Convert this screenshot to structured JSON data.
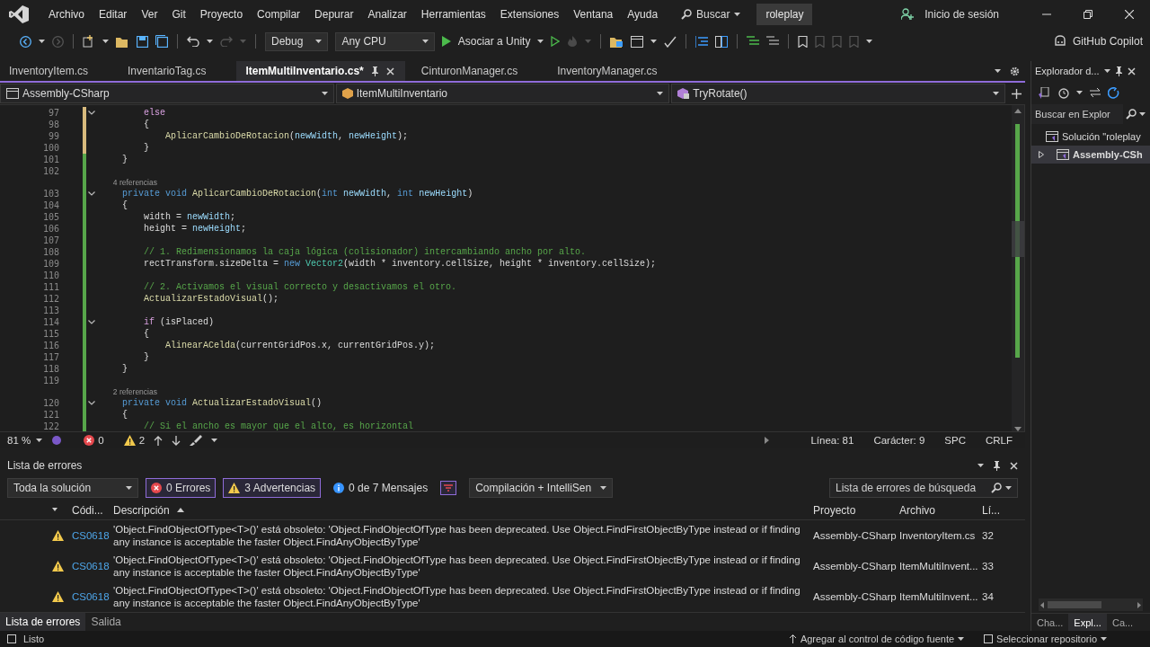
{
  "menu": {
    "items": [
      "Archivo",
      "Editar",
      "Ver",
      "Git",
      "Proyecto",
      "Compilar",
      "Depurar",
      "Analizar",
      "Herramientas",
      "Extensiones",
      "Ventana",
      "Ayuda"
    ],
    "search": "Buscar",
    "solution": "roleplay",
    "signin": "Inicio de sesión"
  },
  "toolbar": {
    "configuration": "Debug",
    "platform": "Any CPU",
    "run": "Asociar a Unity",
    "copilot": "GitHub Copilot"
  },
  "tabs": [
    {
      "label": "InventoryItem.cs",
      "selected": false
    },
    {
      "label": "InventarioTag.cs",
      "selected": false
    },
    {
      "label": "ItemMultiInventario.cs*",
      "selected": true
    },
    {
      "label": "CinturonManager.cs",
      "selected": false
    },
    {
      "label": "InventoryManager.cs",
      "selected": false
    }
  ],
  "navigation": {
    "project": "Assembly-CSharp",
    "type": "ItemMultiInventario",
    "member": "TryRotate()"
  },
  "code": [
    {
      "kind": "code",
      "number": "97",
      "saved": false,
      "collapsible": true,
      "tokens": [
        {
          "kind": "ctl",
          "text": "            else"
        }
      ]
    },
    {
      "kind": "code",
      "number": "98",
      "saved": false,
      "collapsible": false,
      "tokens": [
        {
          "kind": "p",
          "text": "            {"
        }
      ]
    },
    {
      "kind": "code",
      "number": "99",
      "saved": false,
      "collapsible": false,
      "tokens": [
        {
          "kind": "fn",
          "text": "                AplicarCambioDeRotacion"
        },
        {
          "kind": "p",
          "text": "("
        },
        {
          "kind": "param",
          "text": "newWidth"
        },
        {
          "kind": "p",
          "text": ", "
        },
        {
          "kind": "param",
          "text": "newHeight"
        },
        {
          "kind": "p",
          "text": ");"
        }
      ]
    },
    {
      "kind": "code",
      "number": "100",
      "saved": false,
      "collapsible": false,
      "tokens": [
        {
          "kind": "p",
          "text": "            }"
        }
      ]
    },
    {
      "kind": "code",
      "number": "101",
      "saved": true,
      "collapsible": false,
      "tokens": [
        {
          "kind": "p",
          "text": "        }"
        }
      ]
    },
    {
      "kind": "code",
      "number": "102",
      "saved": true,
      "collapsible": false
    },
    {
      "kind": "refs",
      "saved": true,
      "text": "4 referencias"
    },
    {
      "kind": "code",
      "number": "103",
      "saved": true,
      "collapsible": true,
      "tokens": [
        {
          "kind": "kw",
          "text": "        private void "
        },
        {
          "kind": "fn",
          "text": "AplicarCambioDeRotacion"
        },
        {
          "kind": "p",
          "text": "("
        },
        {
          "kind": "kw",
          "text": "int "
        },
        {
          "kind": "param",
          "text": "newWidth"
        },
        {
          "kind": "p",
          "text": ", "
        },
        {
          "kind": "kw",
          "text": "int "
        },
        {
          "kind": "param",
          "text": "newHeight"
        },
        {
          "kind": "p",
          "text": ")"
        }
      ]
    },
    {
      "kind": "code",
      "number": "104",
      "saved": true,
      "collapsible": false,
      "tokens": [
        {
          "kind": "p",
          "text": "        {"
        }
      ]
    },
    {
      "kind": "code",
      "number": "105",
      "saved": true,
      "collapsible": false,
      "tokens": [
        {
          "kind": "p",
          "text": "            width = "
        },
        {
          "kind": "param",
          "text": "newWidth"
        },
        {
          "kind": "p",
          "text": ";"
        }
      ]
    },
    {
      "kind": "code",
      "number": "106",
      "saved": true,
      "collapsible": false,
      "tokens": [
        {
          "kind": "p",
          "text": "            height = "
        },
        {
          "kind": "param",
          "text": "newHeight"
        },
        {
          "kind": "p",
          "text": ";"
        }
      ]
    },
    {
      "kind": "code",
      "number": "107",
      "saved": true,
      "collapsible": false
    },
    {
      "kind": "code",
      "number": "108",
      "saved": true,
      "collapsible": false,
      "tokens": [
        {
          "kind": "c",
          "text": "            // 1. Redimensionamos la caja lógica (colisionador) intercambiando ancho por alto."
        }
      ]
    },
    {
      "kind": "code",
      "number": "109",
      "saved": true,
      "collapsible": false,
      "tokens": [
        {
          "kind": "p",
          "text": "            rectTransform.sizeDelta = "
        },
        {
          "kind": "kw",
          "text": "new "
        },
        {
          "kind": "type",
          "text": "Vector2"
        },
        {
          "kind": "p",
          "text": "(width * inventory.cellSize, height * inventory.cellSize);"
        }
      ]
    },
    {
      "kind": "code",
      "number": "110",
      "saved": true,
      "collapsible": false
    },
    {
      "kind": "code",
      "number": "111",
      "saved": true,
      "collapsible": false,
      "tokens": [
        {
          "kind": "c",
          "text": "            // 2. Activamos el visual correcto y desactivamos el otro."
        }
      ]
    },
    {
      "kind": "code",
      "number": "112",
      "saved": true,
      "collapsible": false,
      "tokens": [
        {
          "kind": "fn",
          "text": "            ActualizarEstadoVisual"
        },
        {
          "kind": "p",
          "text": "();"
        }
      ]
    },
    {
      "kind": "code",
      "number": "113",
      "saved": true,
      "collapsible": false
    },
    {
      "kind": "code",
      "number": "114",
      "saved": true,
      "collapsible": true,
      "tokens": [
        {
          "kind": "ctl",
          "text": "            if "
        },
        {
          "kind": "p",
          "text": "(isPlaced)"
        }
      ]
    },
    {
      "kind": "code",
      "number": "115",
      "saved": true,
      "collapsible": false,
      "tokens": [
        {
          "kind": "p",
          "text": "            {"
        }
      ]
    },
    {
      "kind": "code",
      "number": "116",
      "saved": true,
      "collapsible": false,
      "tokens": [
        {
          "kind": "fn",
          "text": "                AlinearACelda"
        },
        {
          "kind": "p",
          "text": "(currentGridPos.x, currentGridPos.y);"
        }
      ]
    },
    {
      "kind": "code",
      "number": "117",
      "saved": true,
      "collapsible": false,
      "tokens": [
        {
          "kind": "p",
          "text": "            }"
        }
      ]
    },
    {
      "kind": "code",
      "number": "118",
      "saved": true,
      "collapsible": false,
      "tokens": [
        {
          "kind": "p",
          "text": "        }"
        }
      ]
    },
    {
      "kind": "code",
      "number": "119",
      "saved": true,
      "collapsible": false
    },
    {
      "kind": "refs",
      "saved": true,
      "text": "2 referencias"
    },
    {
      "kind": "code",
      "number": "120",
      "saved": true,
      "collapsible": true,
      "tokens": [
        {
          "kind": "kw",
          "text": "        private void "
        },
        {
          "kind": "fn",
          "text": "ActualizarEstadoVisual"
        },
        {
          "kind": "p",
          "text": "()"
        }
      ]
    },
    {
      "kind": "code",
      "number": "121",
      "saved": true,
      "collapsible": false,
      "tokens": [
        {
          "kind": "p",
          "text": "        {"
        }
      ]
    },
    {
      "kind": "code",
      "number": "122",
      "saved": true,
      "collapsible": false,
      "tokens": [
        {
          "kind": "c",
          "text": "            // Si el ancho es mayor que el alto, es horizontal"
        }
      ]
    }
  ],
  "editor_status": {
    "zoom": "81 %",
    "errors": "0",
    "warnings": "2",
    "line": "Línea: 81",
    "column": "Carácter: 9",
    "indent": "SPC",
    "line_ending": "CRLF"
  },
  "error_list": {
    "title": "Lista de errores",
    "scope": "Toda la solución",
    "filters": [
      {
        "kind": "error",
        "label": "0 Errores",
        "on": true
      },
      {
        "kind": "warning",
        "label": "3 Advertencias",
        "on": true
      },
      {
        "kind": "info",
        "label": "0 de 7 Mensajes",
        "on": false
      }
    ],
    "build": "Compilación + IntelliSen",
    "search_placeholder": "Lista de errores de búsqueda",
    "columns": [
      "Códi...",
      "Descripción",
      "Proyecto",
      "Archivo",
      "Lí..."
    ],
    "rows": [
      {
        "kind": "warning",
        "code": "CS0618",
        "description": "'Object.FindObjectOfType<T>()' está obsoleto: 'Object.FindObjectOfType has been deprecated. Use Object.FindFirstObjectByType instead or if finding any instance is acceptable the faster Object.FindAnyObjectByType'",
        "project": "Assembly-CSharp",
        "file": "InventoryItem.cs",
        "line": "32"
      },
      {
        "kind": "warning",
        "code": "CS0618",
        "description": "'Object.FindObjectOfType<T>()' está obsoleto: 'Object.FindObjectOfType has been deprecated. Use Object.FindFirstObjectByType instead or if finding any instance is acceptable the faster Object.FindAnyObjectByType'",
        "project": "Assembly-CSharp",
        "file": "ItemMultiInvent...",
        "line": "33"
      },
      {
        "kind": "warning",
        "code": "CS0618",
        "description": "'Object.FindObjectOfType<T>()' está obsoleto: 'Object.FindObjectOfType has been deprecated. Use Object.FindFirstObjectByType instead or if finding any instance is acceptable the faster Object.FindAnyObjectByType'",
        "project": "Assembly-CSharp",
        "file": "ItemMultiInvent...",
        "line": "34"
      }
    ]
  },
  "bottom_tabs": [
    {
      "label": "Lista de errores",
      "selected": true
    },
    {
      "label": "Salida",
      "selected": false
    }
  ],
  "explorer": {
    "title": "Explorador d...",
    "search_placeholder": "Buscar en Explor",
    "tree": [
      {
        "label": "Solución \"roleplay",
        "selected": false,
        "children": [
          {
            "label": "Assembly-CSh",
            "selected": true,
            "expanded": false
          }
        ]
      }
    ],
    "tabs": [
      {
        "label": "Cha...",
        "selected": false
      },
      {
        "label": "Expl...",
        "selected": true
      },
      {
        "label": "Ca...",
        "selected": false
      }
    ]
  },
  "status_bar": {
    "state": "Listo",
    "source_control": "Agregar al control de código fuente",
    "repository": "Seleccionar repositorio"
  }
}
